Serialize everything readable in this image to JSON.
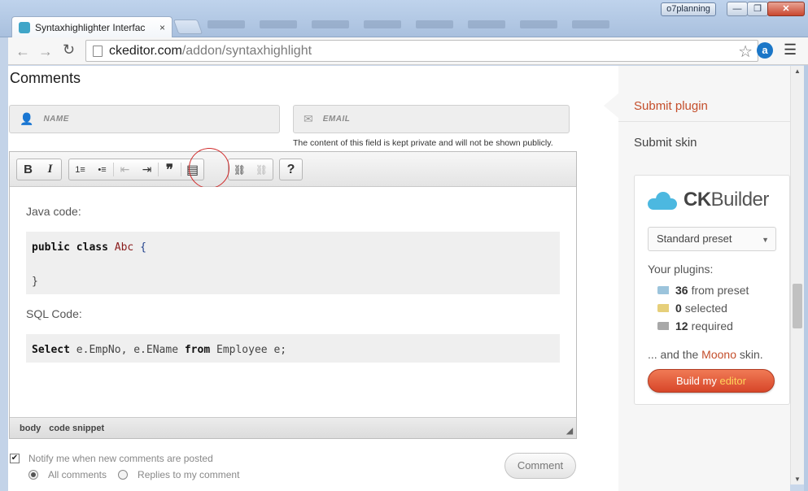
{
  "window": {
    "tab_title": "Syntaxhighlighter Interfac",
    "tab_close": "×",
    "profile_badge": "o7planning",
    "min": "—",
    "max": "❐",
    "close": "✕"
  },
  "toolbar": {
    "back": "←",
    "forward": "→",
    "reload": "↻",
    "url_host": "ckeditor.com",
    "url_path": "/addon/syntaxhighlight",
    "star": "☆",
    "ext": "a",
    "menu": "☰"
  },
  "page": {
    "title": "Comments",
    "name_placeholder": "NAME",
    "email_placeholder": "EMAIL",
    "privacy_note": "The content of this field is kept private and will not be shown publicly."
  },
  "editor": {
    "toolbar": {
      "bold": "B",
      "italic": "I",
      "numbered_list": "1≡",
      "bulleted_list": "•≡",
      "outdent": "⇤",
      "indent": "⇥",
      "blockquote": "❞",
      "code_snippet": "▤",
      "link": "⛓",
      "unlink": "⛓",
      "help": "?"
    },
    "java_label": "Java code:",
    "java_code": {
      "kw1": "public",
      "kw2": "class",
      "cls": "Abc",
      "open": "{",
      "close": "}"
    },
    "sql_label": "SQL Code:",
    "sql_code": {
      "kw1": "Select",
      "part1": " e.EmpNo, e.EName ",
      "kw2": "from",
      "part2": " Employee e;"
    },
    "status": {
      "crumb1": "body",
      "crumb2": "code snippet"
    }
  },
  "form": {
    "notify_label": "Notify me when new comments are posted",
    "radio_all": "All comments",
    "radio_replies": "Replies to my comment",
    "comment_button": "Comment"
  },
  "sidebar": {
    "submit_plugin": "Submit plugin",
    "submit_skin": "Submit skin",
    "ckb_prefix": "CK",
    "ckb_suffix": "Builder",
    "preset": "Standard preset",
    "your_plugins": "Your plugins:",
    "preset_count": "36",
    "preset_text": "from preset",
    "selected_count": "0",
    "selected_text": "selected",
    "required_count": "12",
    "required_text": "required",
    "moono_pre": "... and the ",
    "moono_name": "Moono",
    "moono_post": " skin.",
    "build_pre": "Build my ",
    "build_accent": "editor"
  },
  "colors": {
    "accent": "#c44e2b",
    "build_button": "#e05a37",
    "cloud": "#4cb8e0"
  }
}
